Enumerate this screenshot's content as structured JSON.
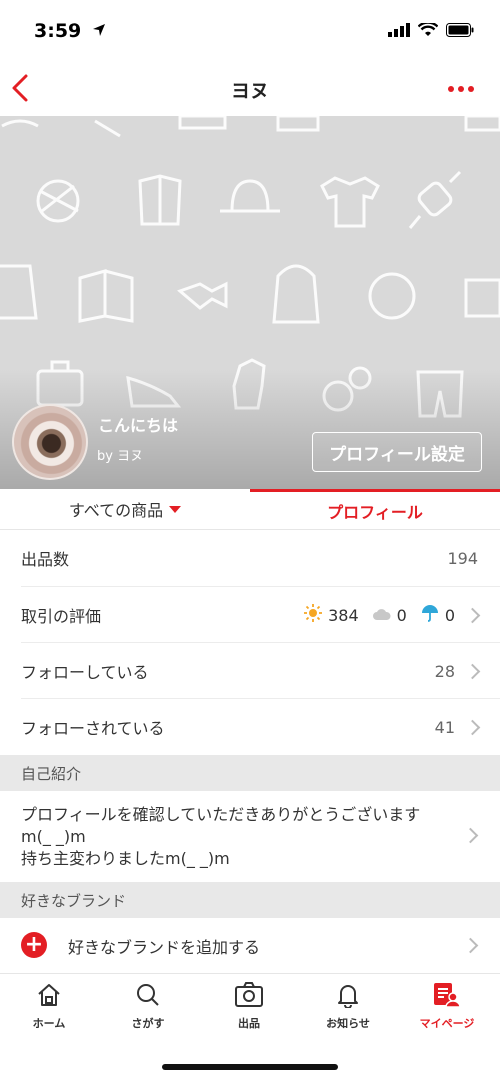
{
  "status_bar": {
    "time": "3:59"
  },
  "nav": {
    "title": "ヨヌ"
  },
  "hero": {
    "name": "こんにちは",
    "by": "by ヨヌ",
    "profile_settings": "プロフィール設定"
  },
  "tabs": {
    "all_items": "すべての商品",
    "profile": "プロフィール"
  },
  "stats": {
    "listings_label": "出品数",
    "listings_value": "194",
    "rating_label": "取引の評価",
    "rating_good": "384",
    "rating_normal": "0",
    "rating_bad": "0",
    "following_label": "フォローしている",
    "following_value": "28",
    "followers_label": "フォローされている",
    "followers_value": "41"
  },
  "intro": {
    "section_title": "自己紹介",
    "text": "プロフィールを確認していただきありがとうございます\nm(_ _)m\n持ち主変わりましたm(_ _)m"
  },
  "brands": {
    "section_title": "好きなブランド",
    "add_label": "好きなブランドを追加する"
  },
  "tabbar": {
    "home": "ホーム",
    "search": "さがす",
    "sell": "出品",
    "notifications": "お知らせ",
    "mypage": "マイページ"
  },
  "colors": {
    "accent": "#e31e24",
    "section_bg": "#e8e8e8",
    "hero_bg": "#d9d9d9"
  }
}
